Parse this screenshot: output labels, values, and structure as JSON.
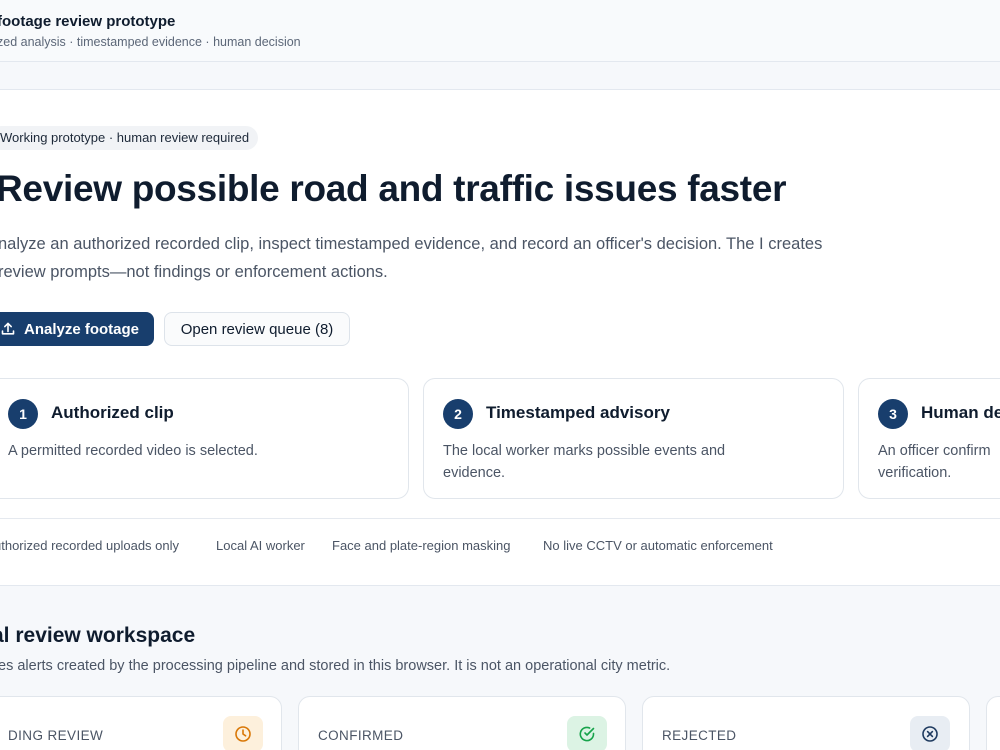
{
  "header": {
    "title": "footage review prototype",
    "subtitle": "zed analysis · timestamped evidence · human decision"
  },
  "hero": {
    "badge": "Working prototype · human review required",
    "title": "Review possible road and traffic issues faster",
    "description": "nalyze an authorized recorded clip, inspect timestamped evidence, and record an officer's decision. The I creates review prompts—not findings or enforcement actions.",
    "primary_button": "Analyze footage",
    "secondary_button": "Open review queue (8)"
  },
  "steps": [
    {
      "number": "1",
      "title": "Authorized clip",
      "description": "A permitted recorded video is selected."
    },
    {
      "number": "2",
      "title": "Timestamped advisory",
      "description": "The local worker marks possible events and evidence."
    },
    {
      "number": "3",
      "title": "Human de",
      "description": "An officer confirm verification."
    }
  ],
  "features": [
    "uthorized recorded uploads only",
    "Local AI worker",
    "Face and plate-region masking",
    "No live CCTV or automatic enforcement"
  ],
  "workspace": {
    "title": "al review workspace",
    "description": "es alerts created by the processing pipeline and stored in this browser. It is not an operational city metric.",
    "stats": [
      {
        "label": "DING REVIEW",
        "icon": "clock-icon",
        "color": "#d97706",
        "bg": "#fdf0dc"
      },
      {
        "label": "CONFIRMED",
        "icon": "check-circle-icon",
        "color": "#16a34a",
        "bg": "#dcf3e4"
      },
      {
        "label": "REJECTED",
        "icon": "x-circle-icon",
        "color": "#1e3a5f",
        "bg": "#e8edf3"
      }
    ]
  },
  "colors": {
    "primary": "#183e6d",
    "background": "#f6f8fb"
  }
}
